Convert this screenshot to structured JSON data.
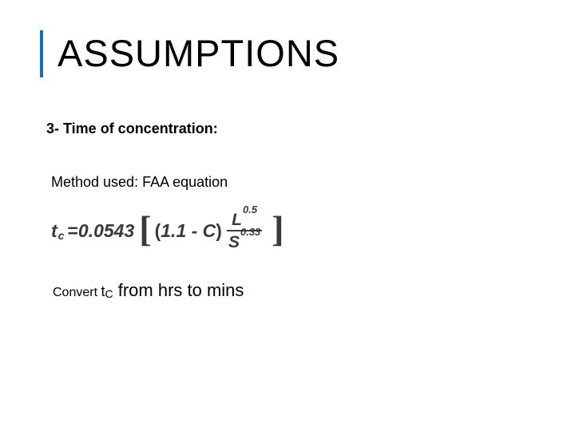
{
  "title": "ASSUMPTIONS",
  "subhead": "3- Time of concentration:",
  "method": "Method used: FAA equation",
  "equation": {
    "var": "t",
    "varsub": "c",
    "eq": " = ",
    "coef": "0.0543",
    "lbr": "[",
    "lpar": "(",
    "inner1": "1.1 - C",
    "rpar": ")",
    "numL": "L",
    "numExp": "0.5",
    "denS": "S",
    "denExp": "0.33",
    "rbr": "]"
  },
  "convert": {
    "prefix": "Convert ",
    "tc_t": "t",
    "tc_c": "C",
    "rest": " from hrs to mins"
  }
}
